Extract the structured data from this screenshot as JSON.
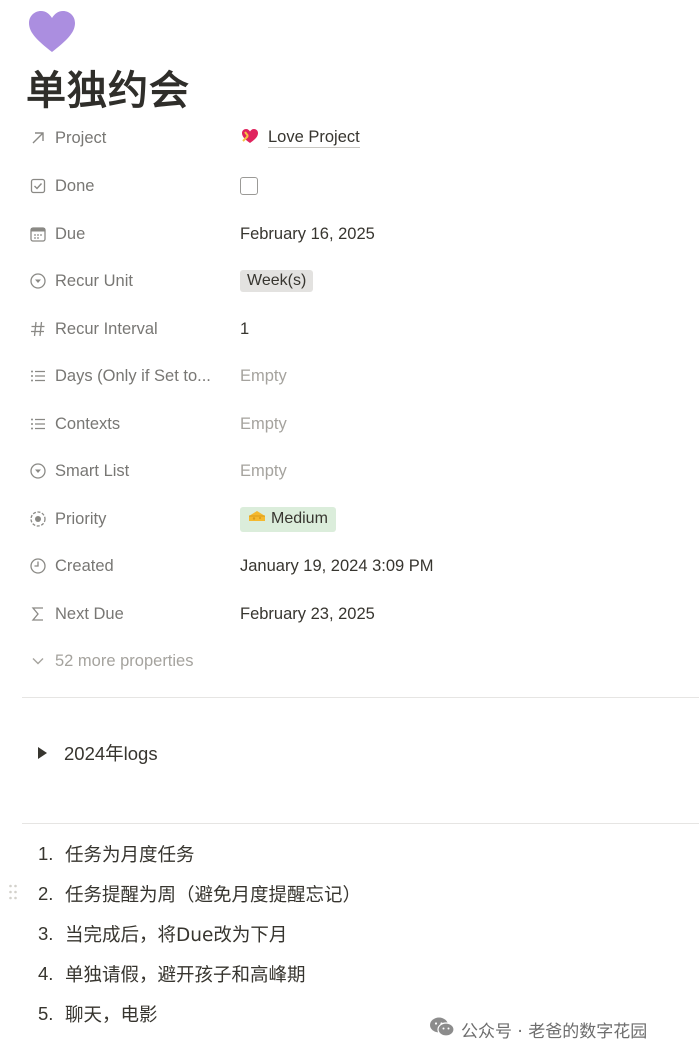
{
  "page": {
    "title": "单独约会",
    "icon": "purple-heart-icon"
  },
  "properties": [
    {
      "name": "Project",
      "icon": "arrow-up-right-icon",
      "value": "Love Project",
      "value_type": "relation"
    },
    {
      "name": "Done",
      "icon": "checkbox-icon",
      "value": "",
      "value_type": "checkbox",
      "checked": false
    },
    {
      "name": "Due",
      "icon": "calendar-icon",
      "value": "February 16, 2025",
      "value_type": "text"
    },
    {
      "name": "Recur Unit",
      "icon": "select-icon",
      "value": "Week(s)",
      "value_type": "tag"
    },
    {
      "name": "Recur Interval",
      "icon": "hash-icon",
      "value": "1",
      "value_type": "text"
    },
    {
      "name": "Days (Only if Set to...",
      "icon": "list-icon",
      "value": "Empty",
      "value_type": "empty"
    },
    {
      "name": "Contexts",
      "icon": "list-icon",
      "value": "Empty",
      "value_type": "empty"
    },
    {
      "name": "Smart List",
      "icon": "select-icon",
      "value": "Empty",
      "value_type": "empty"
    },
    {
      "name": "Priority",
      "icon": "status-icon",
      "value": "Medium",
      "value_type": "tag",
      "tag_icon": "cheese-icon",
      "tag_color": "#dbeddb"
    },
    {
      "name": "Created",
      "icon": "clock-icon",
      "value": "January 19, 2024 3:09 PM",
      "value_type": "text"
    },
    {
      "name": "Next Due",
      "icon": "sigma-icon",
      "value": "February 23, 2025",
      "value_type": "text"
    }
  ],
  "more_properties": "52 more properties",
  "toggle": {
    "label": "2024年logs"
  },
  "list": [
    {
      "num": "1.",
      "text": "任务为月度任务"
    },
    {
      "num": "2.",
      "text": "任务提醒为周（避免月度提醒忘记）"
    },
    {
      "num": "3.",
      "text": "当完成后，将Due改为下月"
    },
    {
      "num": "4.",
      "text": "单独请假，避开孩子和高峰期"
    },
    {
      "num": "5.",
      "text": "聊天，电影"
    }
  ],
  "watermark": "公众号 · 老爸的数字花园"
}
